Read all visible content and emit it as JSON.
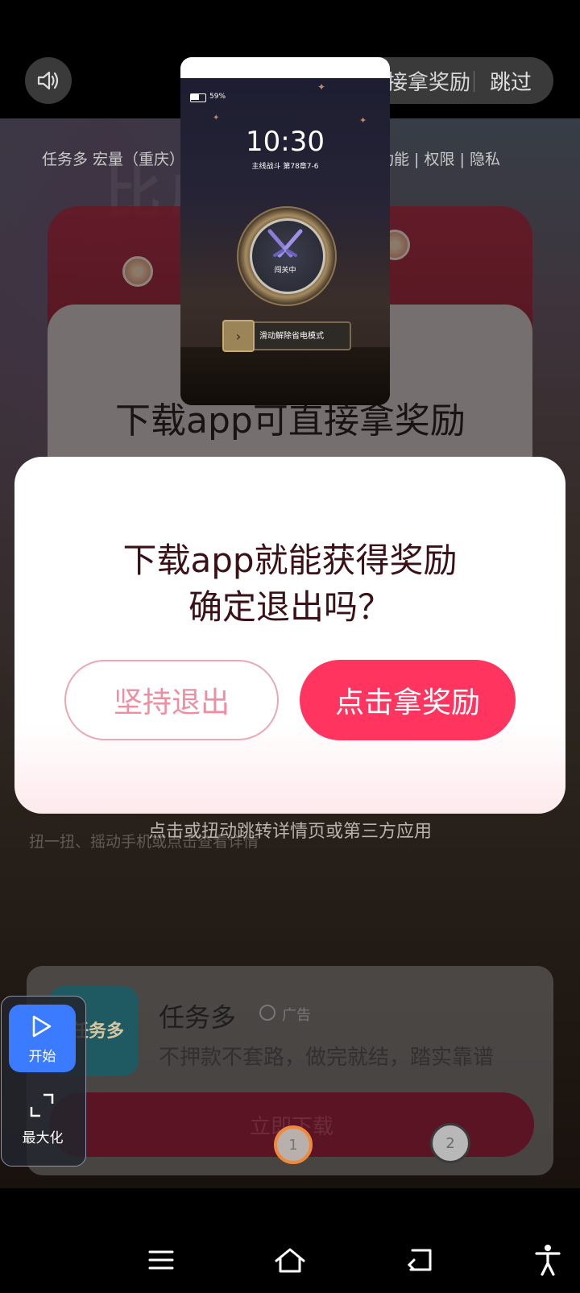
{
  "top_bar": {
    "reward_label": "接拿奖励",
    "skip_label": "跳过",
    "company_text": "任务多 宏量（重庆）",
    "permission_text": "功能 | 权限 | 隐私"
  },
  "ad": {
    "headline": "下载app可直接拿奖励",
    "title_ghost": "比成单"
  },
  "phone_preview": {
    "battery": "59%",
    "time": "10:30",
    "subtitle": "主线战斗 第78章7-6",
    "badge_label": "闯关中",
    "slide_label": "滑动解除省电模式"
  },
  "dialog": {
    "line1": "下载app就能获得奖励",
    "line2": "确定退出吗？",
    "exit_label": "坚持退出",
    "reward_label": "点击拿奖励"
  },
  "below_dialog": {
    "twist_text": "点击或扭动跳转详情页或第三方应用",
    "ghost_text": "扭一扭、摇动手机或点击查看详情"
  },
  "app_card": {
    "icon_text": "任务多",
    "name": "任务多",
    "ad_tag": "广告",
    "description": "不押款不套路，做完就结，踏实靠谱",
    "download_label": "立即下载"
  },
  "float_panel": {
    "start_label": "开始",
    "maximize_label": "最大化"
  },
  "markers": {
    "m1": "1",
    "m2": "2"
  },
  "colors": {
    "accent": "#ff355f",
    "dialog_text": "#3a1116",
    "start_blue": "#3a7bff"
  }
}
